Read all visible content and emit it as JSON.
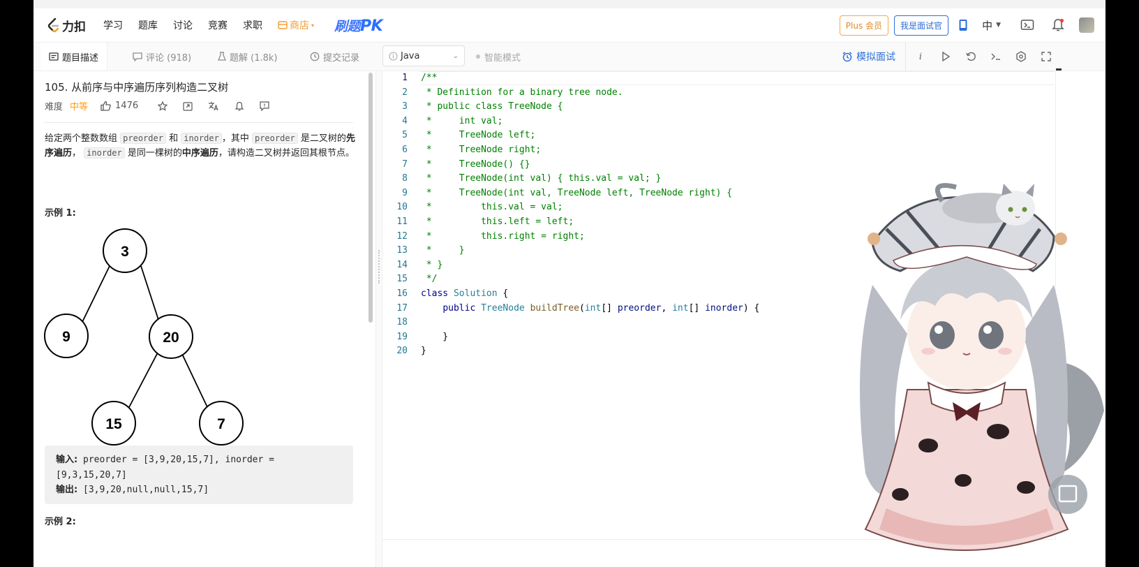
{
  "nav": {
    "logo_text": "力扣",
    "items": [
      "学习",
      "题库",
      "讨论",
      "竞赛",
      "求职"
    ],
    "shop": "商店",
    "pk_prefix": "刷题",
    "pk_suffix": "PK",
    "plus_btn": "Plus 会员",
    "interview_btn": "我是面试官",
    "lang_toggle": "中"
  },
  "tabs": {
    "description": "题目描述",
    "comments": "评论 (918)",
    "solutions": "题解 (1.8k)",
    "submissions": "提交记录",
    "language": "Java",
    "smart_mode": "智能模式",
    "mock_interview": "模拟面试"
  },
  "question": {
    "title": "105. 从前序与中序遍历序列构造二叉树",
    "difficulty_label": "难度",
    "difficulty": "中等",
    "likes": "1476",
    "desc_p1": "给定两个整数数组",
    "code_preorder": "preorder",
    "desc_and": "和",
    "code_inorder": "inorder",
    "desc_where": "，其中",
    "desc_is_tree": "是二叉树的",
    "bold_preorder": "先序遍历",
    "desc_comma": "，",
    "desc_same_tree": "是同一棵树的",
    "bold_inorder": "中序遍历",
    "desc_end": "，请构造二叉树并返回其根节点。",
    "example1_title": "示例 1:",
    "tree_nodes": [
      "3",
      "9",
      "20",
      "15",
      "7"
    ],
    "input_label": "输入:",
    "input_value": " preorder = [3,9,20,15,7], inorder = [9,3,15,20,7]",
    "output_label": "输出:",
    "output_value": " [3,9,20,null,null,15,7]",
    "example2_title": "示例 2:"
  },
  "editor": {
    "line_numbers": [
      "1",
      "2",
      "3",
      "4",
      "5",
      "6",
      "7",
      "8",
      "9",
      "10",
      "11",
      "12",
      "13",
      "14",
      "15",
      "16",
      "17",
      "18",
      "19",
      "20"
    ],
    "lines": [
      "/**",
      " * Definition for a binary tree node.",
      " * public class TreeNode {",
      " *     int val;",
      " *     TreeNode left;",
      " *     TreeNode right;",
      " *     TreeNode() {}",
      " *     TreeNode(int val) { this.val = val; }",
      " *     TreeNode(int val, TreeNode left, TreeNode right) {",
      " *         this.val = val;",
      " *         this.left = left;",
      " *         this.right = right;",
      " *     }",
      " * }",
      " */",
      "class Solution {",
      "    public TreeNode buildTree(int[] preorder, int[] inorder) {",
      "",
      "    }",
      "}"
    ]
  },
  "colors": {
    "accent": "#2d6fd8",
    "difficulty_medium": "#ff9c1a",
    "shop": "#f29b33",
    "plus": "#e08a1e",
    "comment": "#008000",
    "keyword": "#0000ff"
  },
  "icons": [
    "logo-icon",
    "shop-icon",
    "phone-icon",
    "chevron-down-icon",
    "remote-icon",
    "bell-icon",
    "description-icon",
    "comment-icon",
    "flask-icon",
    "clock-icon",
    "info-icon",
    "alarm-icon",
    "italic-info-icon",
    "play-icon",
    "reset-icon",
    "terminal-icon",
    "settings-icon",
    "fullscreen-icon",
    "thumb-up-icon",
    "star-icon",
    "share-icon",
    "translate-icon",
    "bell-outline-icon",
    "feedback-icon"
  ]
}
